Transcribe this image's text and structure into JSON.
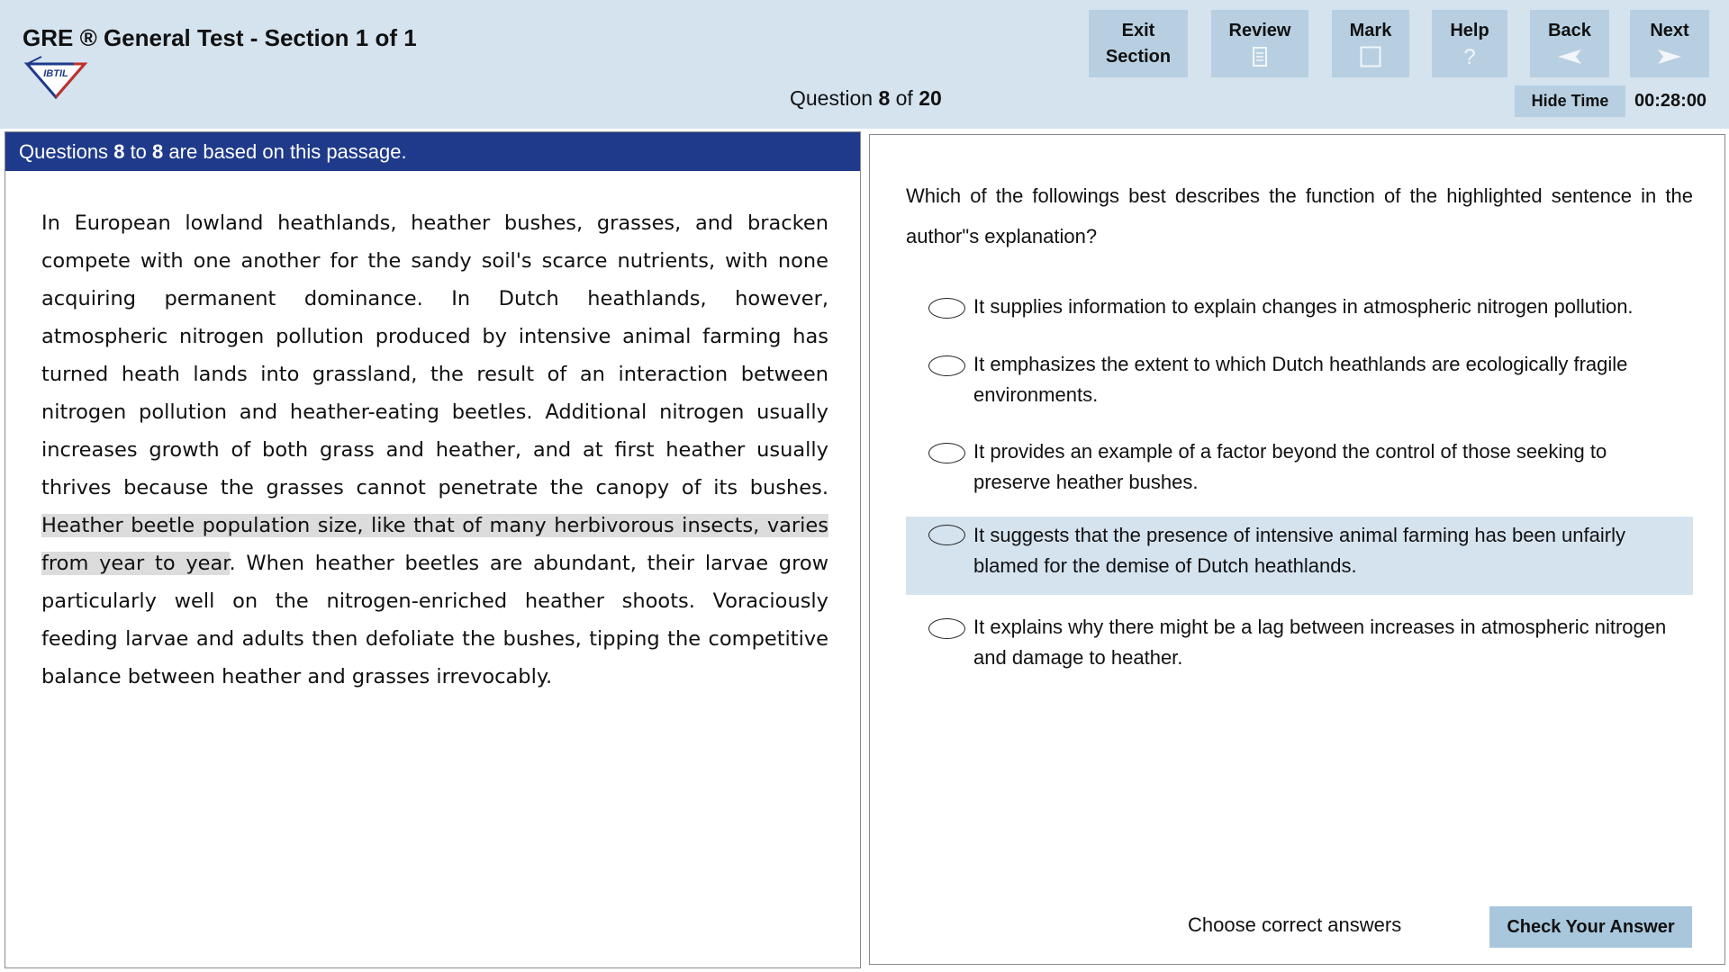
{
  "header": {
    "title": "GRE ® General Test - Section 1 of 1",
    "logo_text": "IBTIL",
    "question_prefix": "Question",
    "question_current": "8",
    "question_of": "of",
    "question_total": "20"
  },
  "toolbar": {
    "exit_line1": "Exit",
    "exit_line2": "Section",
    "review_label": "Review",
    "mark_label": "Mark",
    "help_label": "Help",
    "help_icon": "?",
    "back_label": "Back",
    "next_label": "Next",
    "hide_time_label": "Hide Time",
    "timer": "00:28:00"
  },
  "passage": {
    "header_prefix": "Questions",
    "header_from": "8",
    "header_to_word": "to",
    "header_to": "8",
    "header_suffix": "are based on this passage.",
    "text_before": "In European lowland heathlands, heather bushes, grasses, and bracken compete with one another for the sandy soil's scarce nutrients, with none acquiring permanent dominance. In Dutch heathlands, however, atmospheric nitrogen pollution produced by intensive animal farming has turned heath lands into grassland, the result of an interaction between nitrogen pollution and heather-eating beetles. Additional nitrogen usually increases growth of both grass and heather, and at first heather usually thrives because the grasses cannot penetrate the canopy of its bushes. ",
    "text_highlighted": "Heather beetle population size, like that of many herbivorous insects, varies from year to year",
    "text_after": ". When heather beetles are abundant, their larvae grow particularly well on the nitrogen-enriched heather shoots. Voraciously feeding larvae and adults then defoliate the bushes, tipping the competitive balance between heather and grasses irrevocably."
  },
  "question": {
    "stem": "Which of the followings best describes the function of the highlighted sentence in the author\"s explanation?",
    "options": [
      {
        "text": "It supplies information to explain changes in atmospheric nitrogen pollution.",
        "selected": false
      },
      {
        "text": "It emphasizes the extent to which Dutch heathlands are ecologically fragile environments.",
        "selected": false
      },
      {
        "text": "It provides an example of a factor beyond the control of those seeking to preserve heather bushes.",
        "selected": false
      },
      {
        "text": "It suggests that the presence of intensive animal farming has been unfairly blamed for the demise of Dutch heathlands.",
        "selected": true
      },
      {
        "text": "It explains why there might be a lag between increases in atmospheric nitrogen and damage to heather.",
        "selected": false
      }
    ],
    "instruction": "Choose correct answers",
    "check_button": "Check Your Answer"
  },
  "colors": {
    "header_bg": "#d5e3ef",
    "button_bg": "#b7cfe1",
    "passage_header_bg": "#1f3a8a",
    "selected_option_bg": "#d5e3ef",
    "highlight_bg": "#dcdcdc",
    "check_button_bg": "#a8c7dd"
  },
  "icons": {
    "logo": "ibtil-diamond-logo",
    "review": "document-icon",
    "mark": "checkbox-square-icon",
    "help": "question-mark-icon",
    "back": "arrow-left-icon",
    "next": "arrow-right-icon"
  }
}
